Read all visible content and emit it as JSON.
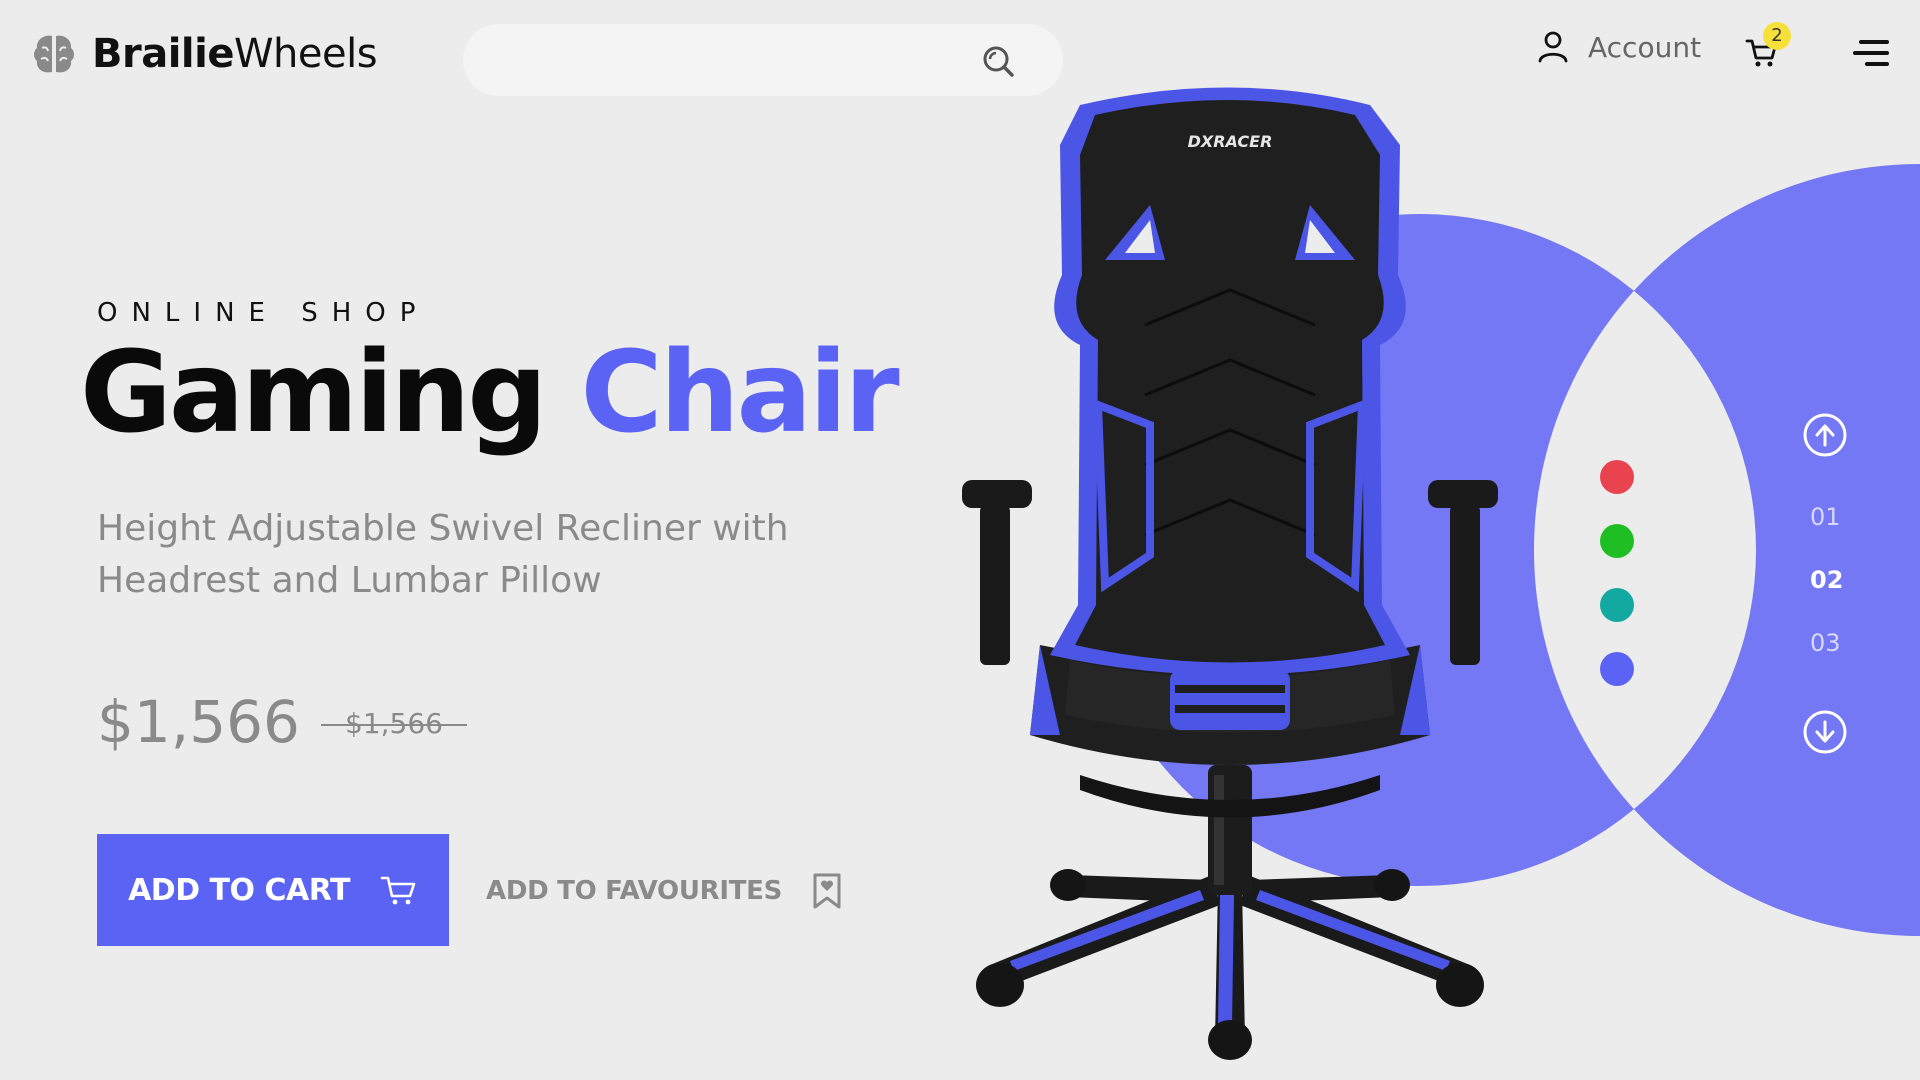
{
  "brand": {
    "name_bold": "Brailie",
    "name_light": "Wheels",
    "logo_icon": "brain-icon"
  },
  "header": {
    "search_placeholder": "",
    "account_label": "Account",
    "cart_count": "2"
  },
  "hero": {
    "kicker": "ONLINE SHOP",
    "title_word1": "Gaming",
    "title_word2": "Chair",
    "subtitle": "Height Adjustable Swivel Recliner with Headrest and Lumbar Pillow",
    "price": "$1,566",
    "old_price": "$1,566",
    "add_to_cart": "ADD TO CART",
    "add_to_favourites": "ADD TO FAVOURITES"
  },
  "product": {
    "brand_mark": "DXRACER"
  },
  "swatches": [
    "#e8434f",
    "#1fbf23",
    "#13a8a0",
    "#5b63f5"
  ],
  "slides": {
    "items": [
      "01",
      "02",
      "03"
    ],
    "active": "02"
  },
  "colors": {
    "accent": "#5b63f5",
    "circle": "#7478f5",
    "background": "#ececec"
  }
}
